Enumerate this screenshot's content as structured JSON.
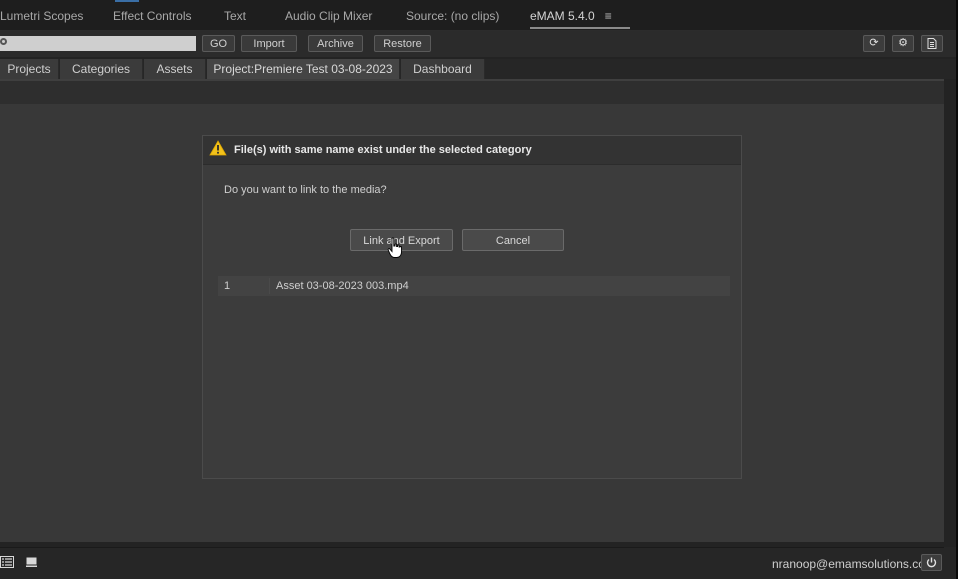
{
  "panel_tabs": [
    {
      "label": "Lumetri Scopes"
    },
    {
      "label": "Effect Controls"
    },
    {
      "label": "Text"
    },
    {
      "label": "Audio Clip Mixer"
    },
    {
      "label": "Source: (no clips)"
    },
    {
      "label": "eMAM 5.4.0",
      "active": true
    }
  ],
  "panel_menu_icon": "hamburger-icon",
  "toolbar": {
    "search_placeholder": "",
    "go_label": "GO",
    "import_label": "Import",
    "archive_label": "Archive",
    "restore_label": "Restore",
    "icons": [
      "refresh-icon",
      "settings-icon",
      "document-icon"
    ]
  },
  "nav_tabs": [
    {
      "label": "Projects"
    },
    {
      "label": "Categories"
    },
    {
      "label": "Assets"
    },
    {
      "label": "Project:Premiere Test 03-08-2023",
      "active": true
    },
    {
      "label": "Dashboard"
    }
  ],
  "dialog": {
    "icon": "warning-icon",
    "title": "File(s) with same name exist under  the selected category",
    "message": "Do you want to link to the media?",
    "primary_button": "Link and Export",
    "secondary_button": "Cancel",
    "files": [
      {
        "index": "1",
        "name": "Asset 03-08-2023 003.mp4"
      }
    ]
  },
  "footer": {
    "view_icons": [
      "list-view-icon",
      "grid-view-icon"
    ],
    "user_email": "nranoop@emamsolutions.com",
    "power_icon": "power-icon"
  },
  "colors": {
    "background": "#232323",
    "content": "#383838",
    "dialog": "#3c3c3c",
    "warning": "#f2c21b",
    "accent": "#3a6ea5"
  }
}
